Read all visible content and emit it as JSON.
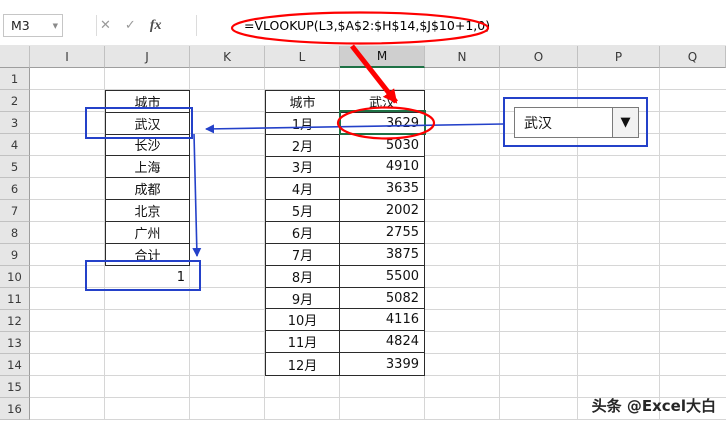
{
  "topbar": {
    "name_box": "M3",
    "name_box_arrow": "▼",
    "cancel": "✕",
    "enter": "✓",
    "fx": "fx",
    "formula": "=VLOOKUP(L3,$A$2:$H$14,$J$10+1,0)"
  },
  "grid": {
    "columns": [
      "I",
      "J",
      "K",
      "L",
      "M",
      "N",
      "O",
      "P",
      "Q"
    ],
    "selected_column": "M",
    "rows": [
      "1",
      "2",
      "3",
      "4",
      "5",
      "6",
      "7",
      "8",
      "9",
      "10",
      "11",
      "12",
      "13",
      "14",
      "15",
      "16"
    ]
  },
  "city_table": {
    "header": "城市",
    "cities": [
      "武汉",
      "长沙",
      "上海",
      "成都",
      "北京",
      "广州",
      "合计"
    ],
    "index_value": "1"
  },
  "month_table": {
    "headers": [
      "城市",
      "武汉"
    ],
    "months": [
      "1月",
      "2月",
      "3月",
      "4月",
      "5月",
      "6月",
      "7月",
      "8月",
      "9月",
      "10月",
      "11月",
      "12月"
    ],
    "values": [
      "3629",
      "5030",
      "4910",
      "3635",
      "2002",
      "2755",
      "3875",
      "5500",
      "5082",
      "4116",
      "4824",
      "3399"
    ]
  },
  "dropdown": {
    "value": "武汉",
    "arrow": "▼"
  },
  "watermark": {
    "text": "头条 @Excel大白"
  },
  "colors": {
    "annotation_red": "#fe0000",
    "annotation_blue": "#2441c9",
    "selection_green": "#1e7145"
  }
}
